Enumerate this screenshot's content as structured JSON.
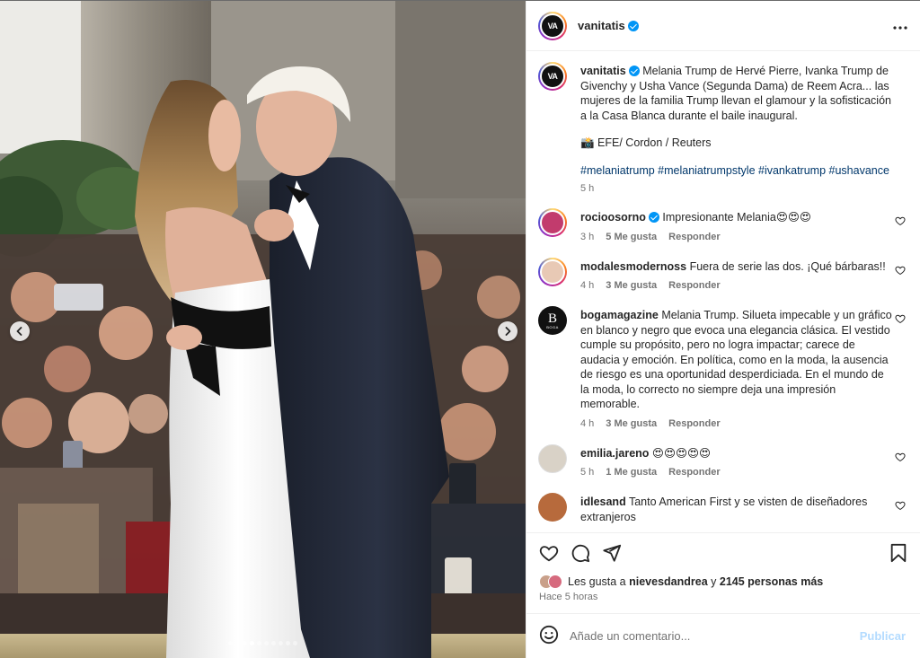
{
  "post": {
    "author": "vanitatis",
    "author_avatar_text": "VA",
    "more_icon": "more-horizontal-icon",
    "slides": {
      "count": 10,
      "active_index": 3
    }
  },
  "caption": {
    "username": "vanitatis",
    "text": "Melania Trump de Hervé Pierre, Ivanka Trump de Givenchy y Usha Vance (Segunda Dama) de Reem Acra... las mujeres de la familia Trump llevan el glamour y la sofisticación a la Casa Blanca durante el baile inaugural.",
    "credit": "📸 EFE/ Cordon / Reuters",
    "hashtags": "#melaniatrump #melaniatrumpstyle #ivankatrump #ushavance",
    "time": "5 h"
  },
  "comments": [
    {
      "username": "rocioosorno",
      "verified": true,
      "text": "Impresionante Melania😍😍😍",
      "time": "3 h",
      "likes": "5 Me gusta",
      "reply": "Responder",
      "avatar_color": "#c23b6d"
    },
    {
      "username": "modalesmodernoss",
      "verified": false,
      "text": "Fuera de serie las dos. ¡Qué bárbaras!!",
      "time": "4 h",
      "likes": "3 Me gusta",
      "reply": "Responder",
      "avatar_color": "#e8c9b5"
    },
    {
      "username": "bogamagazine",
      "verified": false,
      "text": "Melania Trump. Silueta impecable y un gráfico en blanco y negro que evoca una elegancia clásica. El vestido cumple su propósito, pero no logra impactar; carece de audacia y emoción. En política, como en la moda, la ausencia de riesgo es una oportunidad desperdiciada. En el mundo de la moda, lo correcto no siempre deja una impresión memorable.",
      "time": "4 h",
      "likes": "3 Me gusta",
      "reply": "Responder",
      "avatar_text": "B",
      "avatar_subtext": "BOGA",
      "avatar_color": "#111111"
    },
    {
      "username": "emilia.jareno",
      "verified": false,
      "text": "😍😍😍😍😍",
      "time": "5 h",
      "likes": "1 Me gusta",
      "reply": "Responder",
      "avatar_color": "#d9d2c7"
    },
    {
      "username": "idlesand",
      "verified": false,
      "text": "Tanto American First y se visten de diseñadores extranjeros",
      "avatar_color": "#b76a3c"
    }
  ],
  "actions": {
    "like_icon": "heart-icon",
    "comment_icon": "comment-icon",
    "share_icon": "send-icon",
    "save_icon": "bookmark-icon"
  },
  "likes": {
    "prefix": "Les gusta a",
    "user": "nievesdandrea",
    "joiner": "y",
    "others": "2145 personas más"
  },
  "posted": "Hace 5 horas",
  "add_comment": {
    "placeholder": "Añade un comentario...",
    "publish": "Publicar",
    "emoji_icon": "emoji-icon"
  }
}
